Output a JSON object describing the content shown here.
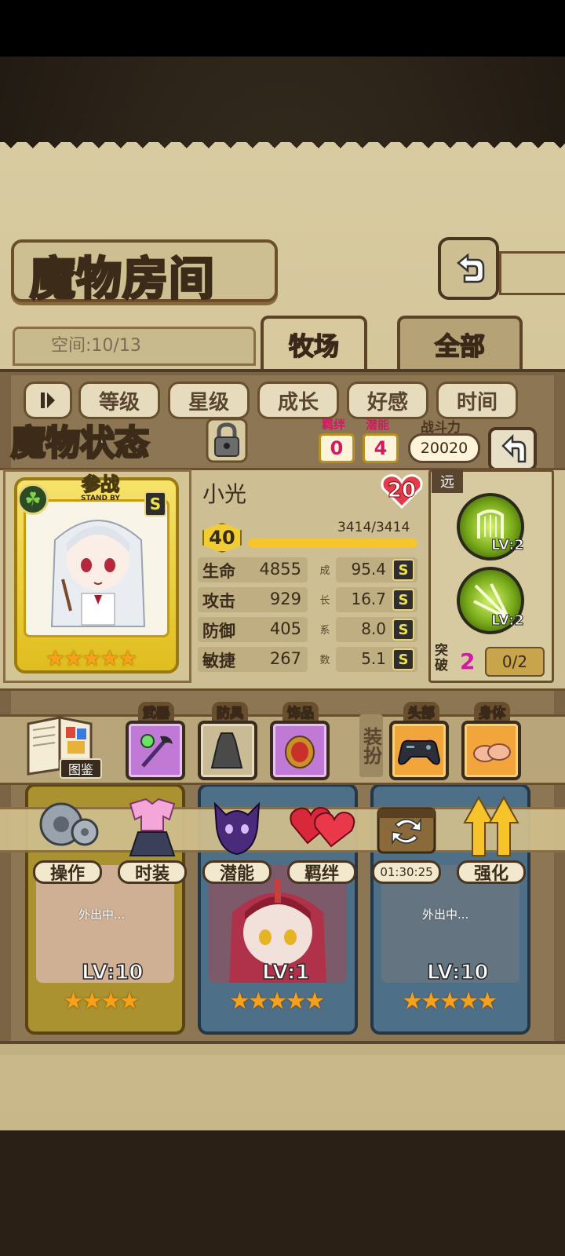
{
  "header": {
    "title": "魔物房间",
    "back_icon": "back-arrow-icon"
  },
  "tabs": {
    "space_label": "空间:10/13",
    "items": [
      {
        "label": "牧场",
        "active": true
      },
      {
        "label": "全部",
        "active": false
      }
    ]
  },
  "sort": {
    "toggle_icon": "pause-sort-icon",
    "buttons": [
      "等级",
      "星级",
      "成长",
      "好感",
      "时间"
    ]
  },
  "status": {
    "title": "魔物状态",
    "bond_label": "羁绊",
    "bond_value": "0",
    "potential_label": "潜能",
    "potential_value": "4",
    "power_label": "战斗力",
    "power_value": "20020"
  },
  "card": {
    "standby_main": "参战",
    "standby_sub": "STAND BY",
    "rarity": "S",
    "stars": "★★★★★"
  },
  "monster": {
    "name": "小光",
    "level": "20",
    "exp_level": "40",
    "exp_text": "3414/3414",
    "exp_fraction": 1.0,
    "stats": [
      {
        "label": "生命",
        "value": "4855",
        "growth": "95.4",
        "grade": "S",
        "growth_char": "成"
      },
      {
        "label": "攻击",
        "value": "929",
        "growth": "16.7",
        "grade": "S",
        "growth_char": "长"
      },
      {
        "label": "防御",
        "value": "405",
        "growth": "8.0",
        "grade": "S",
        "growth_char": "系"
      },
      {
        "label": "敏捷",
        "value": "267",
        "growth": "5.1",
        "grade": "S",
        "growth_char": "数"
      }
    ]
  },
  "skills": {
    "range": "远",
    "items": [
      {
        "lv": "LV:2"
      },
      {
        "lv": "LV:2"
      }
    ],
    "break_label": "突破",
    "break_value": "2",
    "break_progress": "0/2"
  },
  "equipment": {
    "book_label": "图鉴",
    "weapon_label": "武器",
    "armor_label": "防具",
    "accessory_label": "饰品",
    "dress_label": "装扮",
    "head_label": "头部",
    "body_label": "身体"
  },
  "monster_list": [
    {
      "lv": "LV:10",
      "stars": "★★★★",
      "away": "外出中..."
    },
    {
      "lv": "LV:1",
      "stars": "★★★★★",
      "away": ""
    },
    {
      "lv": "LV:10",
      "stars": "★★★★★",
      "away": "外出中..."
    }
  ],
  "menu": {
    "items": [
      {
        "label": "操作",
        "icon": "gear-icon"
      },
      {
        "label": "时装",
        "icon": "outfit-icon"
      },
      {
        "label": "潜能",
        "icon": "demon-icon"
      },
      {
        "label": "羁绊",
        "icon": "hearts-icon"
      },
      {
        "label": "01:30:25",
        "icon": "refresh-chest-icon"
      },
      {
        "label": "强化",
        "icon": "up-arrows-icon"
      }
    ]
  },
  "colors": {
    "paper": "#d9cba1",
    "frame": "#6a4f2e",
    "accent_pink": "#d11a63",
    "exp_gold": "#f4c52c"
  }
}
